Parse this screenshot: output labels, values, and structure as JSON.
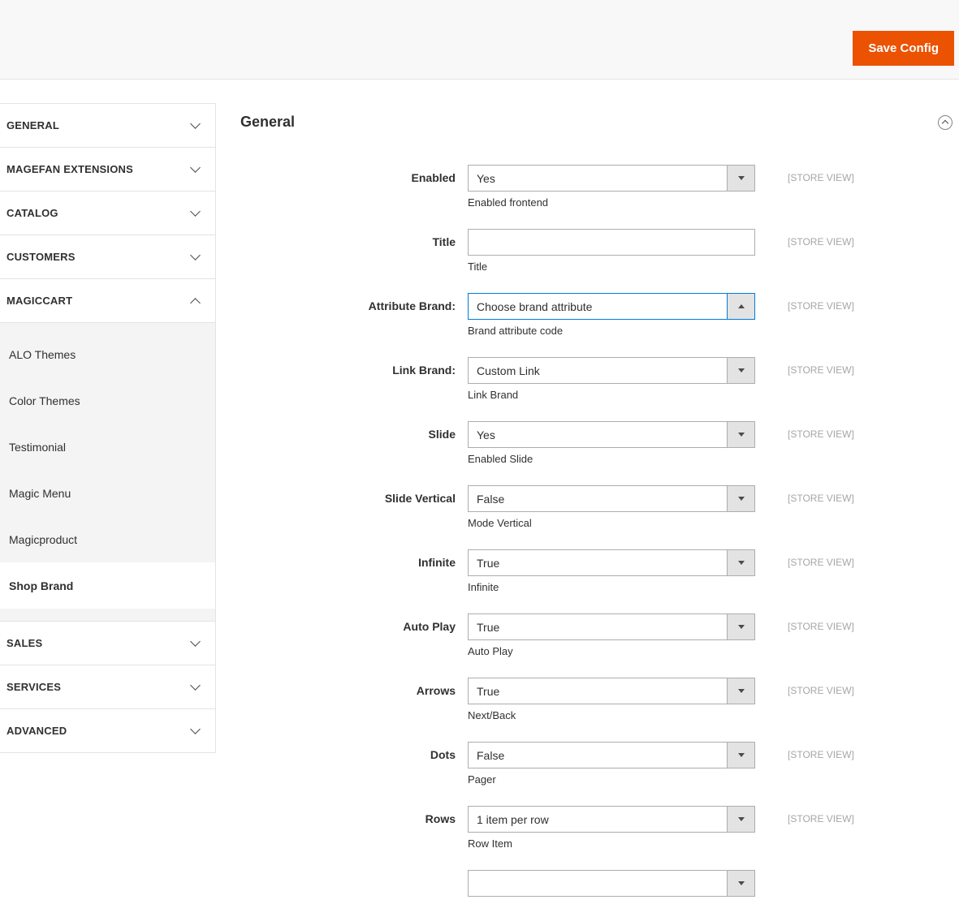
{
  "header": {
    "save_button": "Save Config"
  },
  "colors": {
    "accent_orange": "#eb5202",
    "focus_blue": "#007bdb",
    "header_bg": "#f8f8f8",
    "subnav_bg": "#f4f4f4",
    "border": "#e3e3e3",
    "scope_gray": "#a6a6a6"
  },
  "sidebar": {
    "sections": [
      {
        "label": "GENERAL",
        "state": "collapsed"
      },
      {
        "label": "MAGEFAN EXTENSIONS",
        "state": "collapsed"
      },
      {
        "label": "CATALOG",
        "state": "collapsed"
      },
      {
        "label": "CUSTOMERS",
        "state": "collapsed"
      },
      {
        "label": "MAGICCART",
        "state": "expanded",
        "items": [
          {
            "label": "ALO Themes",
            "active": false
          },
          {
            "label": "Color Themes",
            "active": false
          },
          {
            "label": "Testimonial",
            "active": false
          },
          {
            "label": "Magic Menu",
            "active": false
          },
          {
            "label": "Magicproduct",
            "active": false
          },
          {
            "label": "Shop Brand",
            "active": true
          }
        ]
      },
      {
        "label": "SALES",
        "state": "collapsed"
      },
      {
        "label": "SERVICES",
        "state": "collapsed"
      },
      {
        "label": "ADVANCED",
        "state": "collapsed"
      }
    ]
  },
  "main": {
    "section_title": "General",
    "scope_label": "[STORE VIEW]",
    "fields": [
      {
        "label": "Enabled",
        "value": "Yes",
        "comment": "Enabled frontend",
        "type": "select",
        "focused": false
      },
      {
        "label": "Title",
        "value": "",
        "comment": "Title",
        "type": "text",
        "focused": false
      },
      {
        "label": "Attribute Brand:",
        "value": "Choose brand attribute",
        "comment": "Brand attribute code",
        "type": "select",
        "focused": true
      },
      {
        "label": "Link Brand:",
        "value": "Custom Link",
        "comment": "Link Brand",
        "type": "select",
        "focused": false
      },
      {
        "label": "Slide",
        "value": "Yes",
        "comment": "Enabled Slide",
        "type": "select",
        "focused": false
      },
      {
        "label": "Slide Vertical",
        "value": "False",
        "comment": "Mode Vertical",
        "type": "select",
        "focused": false
      },
      {
        "label": "Infinite",
        "value": "True",
        "comment": "Infinite",
        "type": "select",
        "focused": false
      },
      {
        "label": "Auto Play",
        "value": "True",
        "comment": "Auto Play",
        "type": "select",
        "focused": false
      },
      {
        "label": "Arrows",
        "value": "True",
        "comment": "Next/Back",
        "type": "select",
        "focused": false
      },
      {
        "label": "Dots",
        "value": "False",
        "comment": "Pager",
        "type": "select",
        "focused": false
      },
      {
        "label": "Rows",
        "value": "1 item per row",
        "comment": "Row Item",
        "type": "select",
        "focused": false
      },
      {
        "label": "",
        "value": "",
        "comment": "",
        "type": "select",
        "focused": false,
        "partial": true
      }
    ]
  }
}
